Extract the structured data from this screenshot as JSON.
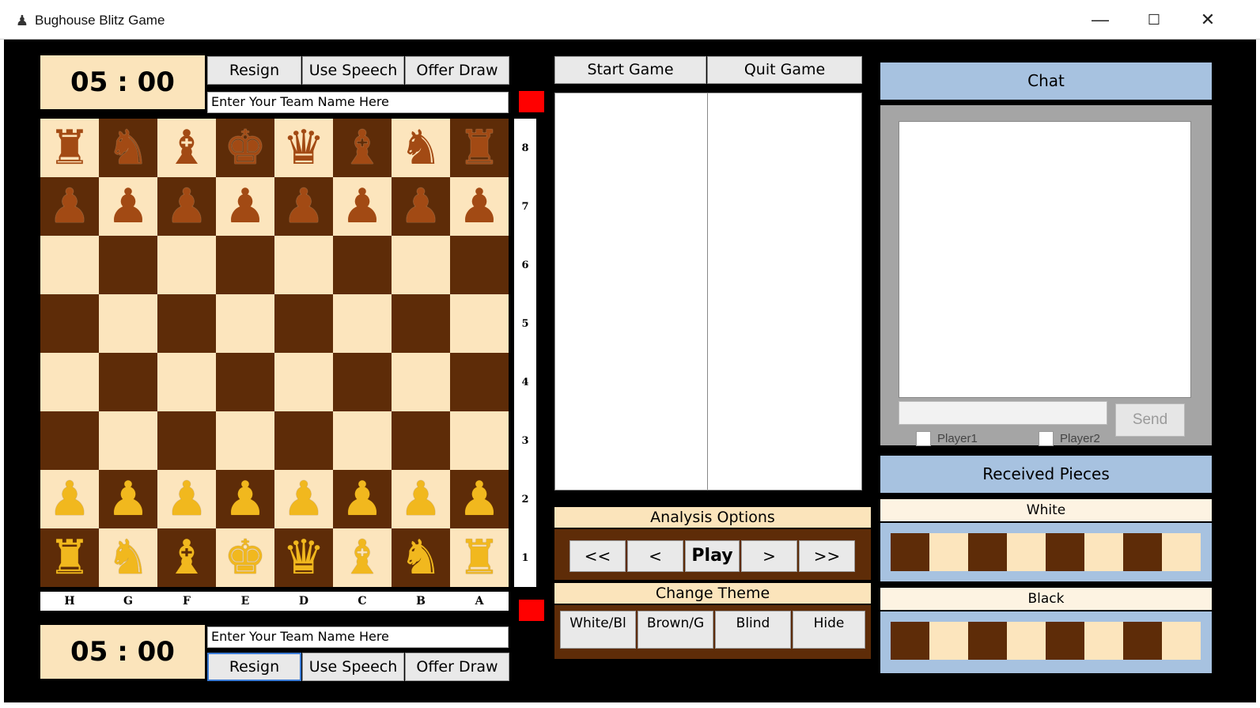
{
  "window": {
    "title": "Bughouse Blitz Game",
    "icon": "chess-pawn-icon",
    "controls": {
      "minimize": "—",
      "maximize": "☐",
      "close": "✕"
    }
  },
  "top_player": {
    "clock": "05 : 00",
    "buttons": {
      "resign": "Resign",
      "speech": "Use Speech",
      "draw": "Offer Draw"
    },
    "team_name_value": "Enter Your Team Name Here"
  },
  "bottom_player": {
    "clock": "05 : 00",
    "buttons": {
      "resign": "Resign",
      "speech": "Use Speech",
      "draw": "Offer Draw"
    },
    "team_name_value": "Enter Your Team Name Here"
  },
  "board": {
    "files": [
      "H",
      "G",
      "F",
      "E",
      "D",
      "C",
      "B",
      "A"
    ],
    "ranks": [
      "8",
      "7",
      "6",
      "5",
      "4",
      "3",
      "2",
      "1"
    ],
    "rows": [
      [
        "b-rook",
        "b-knight",
        "b-bishop",
        "b-king",
        "b-queen",
        "b-bishop",
        "b-knight",
        "b-rook"
      ],
      [
        "b-pawn",
        "b-pawn",
        "b-pawn",
        "b-pawn",
        "b-pawn",
        "b-pawn",
        "b-pawn",
        "b-pawn"
      ],
      [
        "",
        "",
        "",
        "",
        "",
        "",
        "",
        ""
      ],
      [
        "",
        "",
        "",
        "",
        "",
        "",
        "",
        ""
      ],
      [
        "",
        "",
        "",
        "",
        "",
        "",
        "",
        ""
      ],
      [
        "",
        "",
        "",
        "",
        "",
        "",
        "",
        ""
      ],
      [
        "w-pawn",
        "w-pawn",
        "w-pawn",
        "w-pawn",
        "w-pawn",
        "w-pawn",
        "w-pawn",
        "w-pawn"
      ],
      [
        "w-rook",
        "w-knight",
        "w-bishop",
        "w-king",
        "w-queen",
        "w-bishop",
        "w-knight",
        "w-rook"
      ]
    ],
    "colors": {
      "light": "#fce5bd",
      "dark": "#5e2c08",
      "black_piece": "#a24a14",
      "white_piece": "#f1b81e"
    }
  },
  "game_controls": {
    "start": "Start Game",
    "quit": "Quit Game"
  },
  "analysis": {
    "title": "Analysis Options",
    "buttons": {
      "first": "<<",
      "prev": "<",
      "play": "Play",
      "next": ">",
      "last": ">>"
    }
  },
  "theme": {
    "title": "Change Theme",
    "buttons": {
      "white_black": "White/Bl",
      "brown_gold": "Brown/G",
      "blind": "Blind",
      "hide": "Hide"
    }
  },
  "chat": {
    "title": "Chat",
    "send_label": "Send",
    "checkboxes": {
      "player1": "Player1",
      "player2": "Player2"
    }
  },
  "received": {
    "title": "Received Pieces",
    "white_label": "White",
    "black_label": "Black"
  }
}
